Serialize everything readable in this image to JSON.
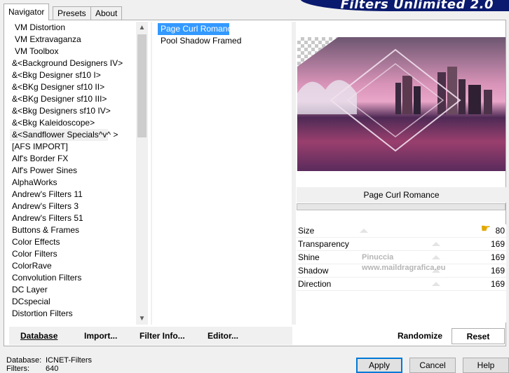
{
  "banner": {
    "title": "Filters Unlimited 2.0"
  },
  "tabs": [
    {
      "label": "Navigator"
    },
    {
      "label": "Presets"
    },
    {
      "label": "About"
    }
  ],
  "categories": {
    "selected": "&<Sandflower Specials^v^ >",
    "items": [
      "VM Distortion",
      "VM Extravaganza",
      "VM Toolbox",
      "&<Background Designers IV>",
      "&<Bkg Designer sf10 I>",
      "&<BKg Designer sf10 II>",
      "&<BKg Designer sf10 III>",
      "&<Bkg Designers sf10 IV>",
      "&<Bkg Kaleidoscope>",
      "&<Sandflower Specials^v^ >",
      "[AFS IMPORT]",
      "Alf's Border FX",
      "Alf's Power Sines",
      "AlphaWorks",
      "Andrew's Filters 11",
      "Andrew's Filters 3",
      "Andrew's Filters 51",
      "Buttons & Frames",
      "Color Effects",
      "Color Filters",
      "ColorRave",
      "Convolution Filters",
      "DC Layer",
      "DCspecial",
      "Distortion Filters"
    ]
  },
  "filters": {
    "selected": "Page Curl Romance",
    "items": [
      "Page Curl Romance",
      "Pool Shadow Framed"
    ]
  },
  "current_filter": "Page Curl Romance",
  "params": [
    {
      "label": "Size",
      "value": "80"
    },
    {
      "label": "Transparency",
      "value": "169"
    },
    {
      "label": "Shine",
      "value": "169"
    },
    {
      "label": "Shadow",
      "value": "169"
    },
    {
      "label": "Direction",
      "value": "169"
    }
  ],
  "watermark": {
    "line1": "Pinuccia",
    "line2": "www.maildragrafica.eu"
  },
  "left_buttons": {
    "database": "Database",
    "import": "Import...",
    "filter_info": "Filter Info...",
    "editor": "Editor..."
  },
  "right_buttons": {
    "randomize": "Randomize",
    "reset": "Reset"
  },
  "status": {
    "database_label": "Database:",
    "database_value": "ICNET-Filters",
    "filters_label": "Filters:",
    "filters_value": "640"
  },
  "dialog_buttons": {
    "apply": "Apply",
    "cancel": "Cancel",
    "help": "Help"
  },
  "colors": {
    "banner": "#0a1a6e",
    "selection": "#3399ff",
    "default_border": "#0078d7"
  }
}
